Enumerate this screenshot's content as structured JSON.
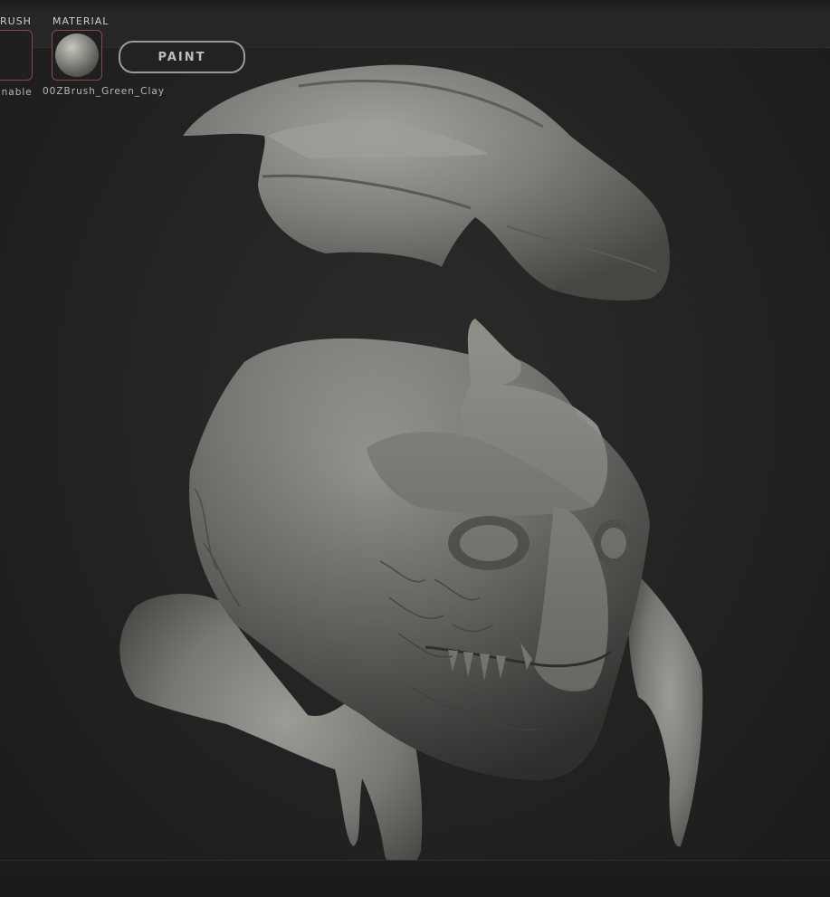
{
  "shelf": {
    "brush_label": "RUSH",
    "brush_enable": "Enable",
    "material_label": "MATERIAL",
    "material_name": "00ZBrush_Green_Clay",
    "paint_button": "PAINT"
  },
  "viewport": {
    "model_material_color": "#8a8b86"
  }
}
